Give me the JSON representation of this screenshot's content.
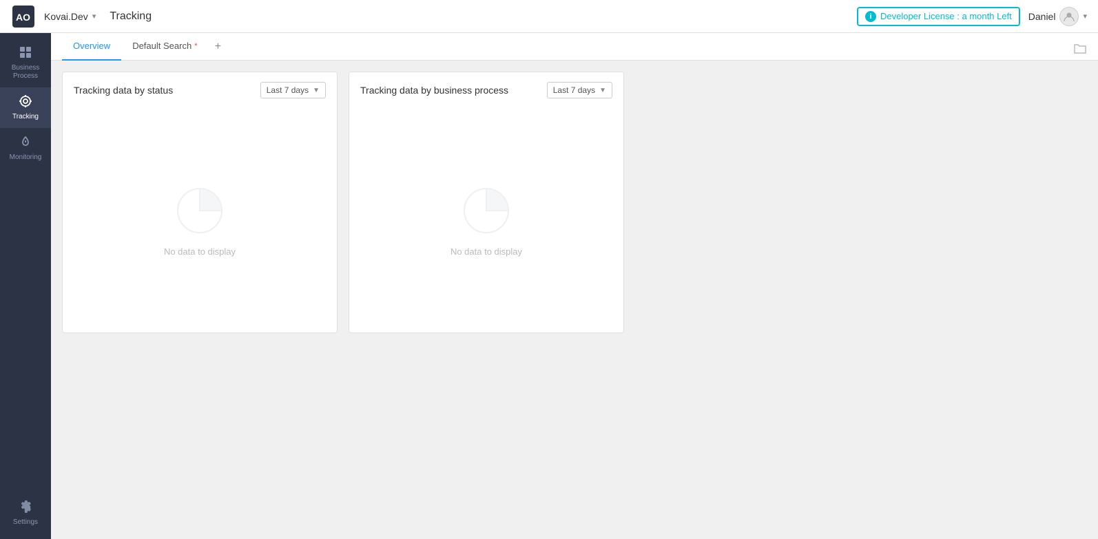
{
  "header": {
    "logo_text": "AO",
    "workspace": "Kovai.Dev",
    "page_title": "Tracking",
    "license_text": "Developer License : a month Left",
    "user_name": "Daniel",
    "chevron": "▾",
    "folder_icon": "🗂"
  },
  "sidebar": {
    "items": [
      {
        "id": "business-process",
        "label": "Business Process",
        "icon": "⊞",
        "active": false
      },
      {
        "id": "tracking",
        "label": "Tracking",
        "icon": "◎",
        "active": true
      },
      {
        "id": "monitoring",
        "label": "Monitoring",
        "icon": "♡",
        "active": false
      }
    ],
    "bottom_items": [
      {
        "id": "settings",
        "label": "Settings",
        "icon": "⚙",
        "active": false
      }
    ]
  },
  "tabs": [
    {
      "id": "overview",
      "label": "Overview",
      "active": true
    },
    {
      "id": "default-search",
      "label": "Default Search",
      "modified": true,
      "active": false
    }
  ],
  "cards": [
    {
      "id": "status-card",
      "title": "Tracking data by status",
      "dropdown_value": "Last 7 days",
      "no_data_text": "No data to display"
    },
    {
      "id": "business-process-card",
      "title": "Tracking data by business process",
      "dropdown_value": "Last 7 days",
      "no_data_text": "No data to display"
    }
  ],
  "icons": {
    "info": "i",
    "chevron_down": "▾",
    "add_tab": "+",
    "user_icon": "👤"
  }
}
